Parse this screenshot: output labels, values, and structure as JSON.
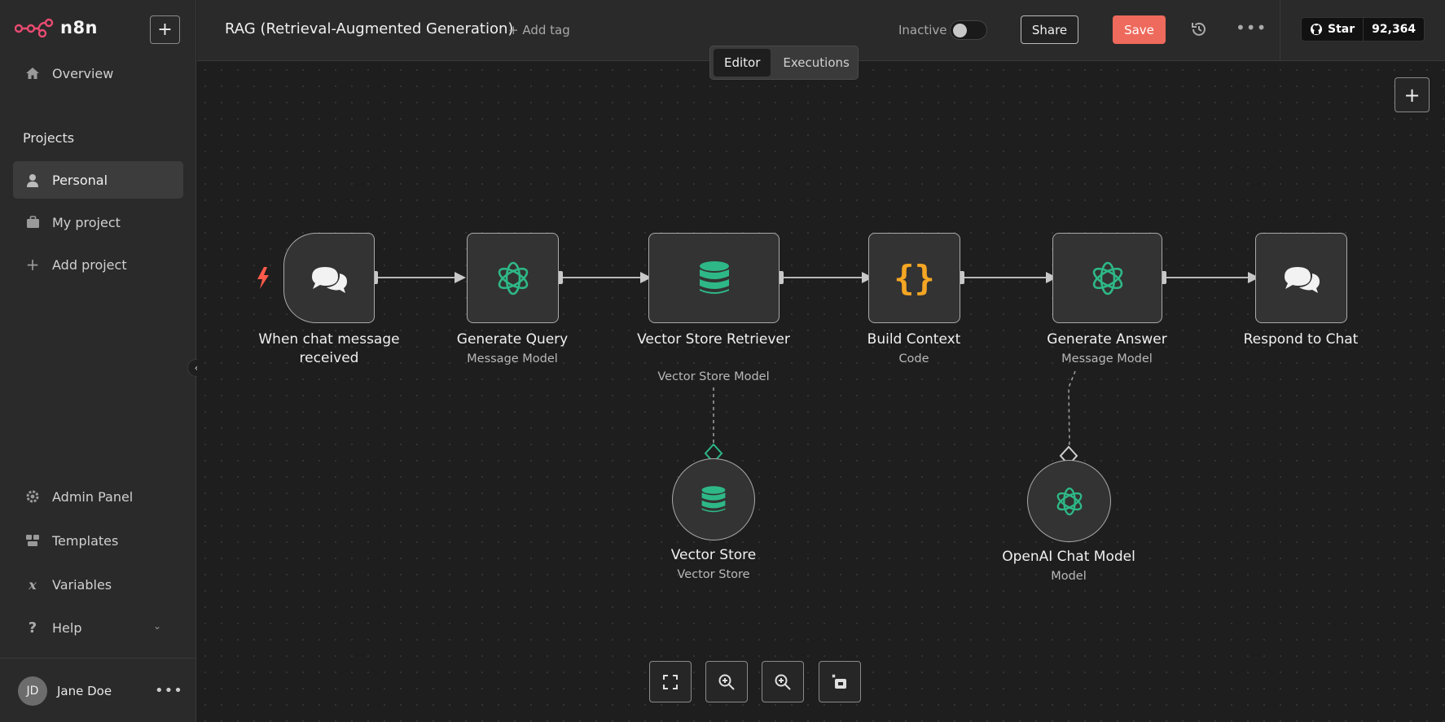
{
  "app": {
    "name": "n8n"
  },
  "sidebar": {
    "overview": "Overview",
    "projects_title": "Projects",
    "personal": "Personal",
    "my_project": "My project",
    "add_project": "Add project",
    "admin_panel": "Admin Panel",
    "templates": "Templates",
    "variables": "Variables",
    "help": "Help",
    "user": {
      "initials": "JD",
      "name": "Jane Doe"
    }
  },
  "header": {
    "workflow_title": "RAG (Retrieval-Augmented Generation)",
    "add_tag": "+ Add tag",
    "status": "Inactive",
    "share": "Share",
    "save": "Save",
    "github_star": "Star",
    "github_count": "92,364"
  },
  "tabs": {
    "editor": "Editor",
    "executions": "Executions",
    "active": "Editor"
  },
  "nodes": {
    "chat_trigger": {
      "title": "When chat message received"
    },
    "generate_query": {
      "title": "Generate Query",
      "sub": "Message Model"
    },
    "retriever": {
      "title": "Vector Store Retriever",
      "sub": "Vector Store Model"
    },
    "build_context": {
      "title": "Build Context",
      "sub": "Code"
    },
    "generate_answer": {
      "title": "Generate Answer",
      "sub": "Message Model"
    },
    "respond": {
      "title": "Respond to Chat"
    },
    "vector_store": {
      "title": "Vector Store",
      "sub": "Vector Store"
    },
    "openai_model": {
      "title": "OpenAI Chat Model",
      "sub": "Model"
    }
  },
  "colors": {
    "accent": "#ee6a5c",
    "openai_green": "#2eb887",
    "code_orange": "#f5a623",
    "trigger_red": "#ff5a4a"
  }
}
